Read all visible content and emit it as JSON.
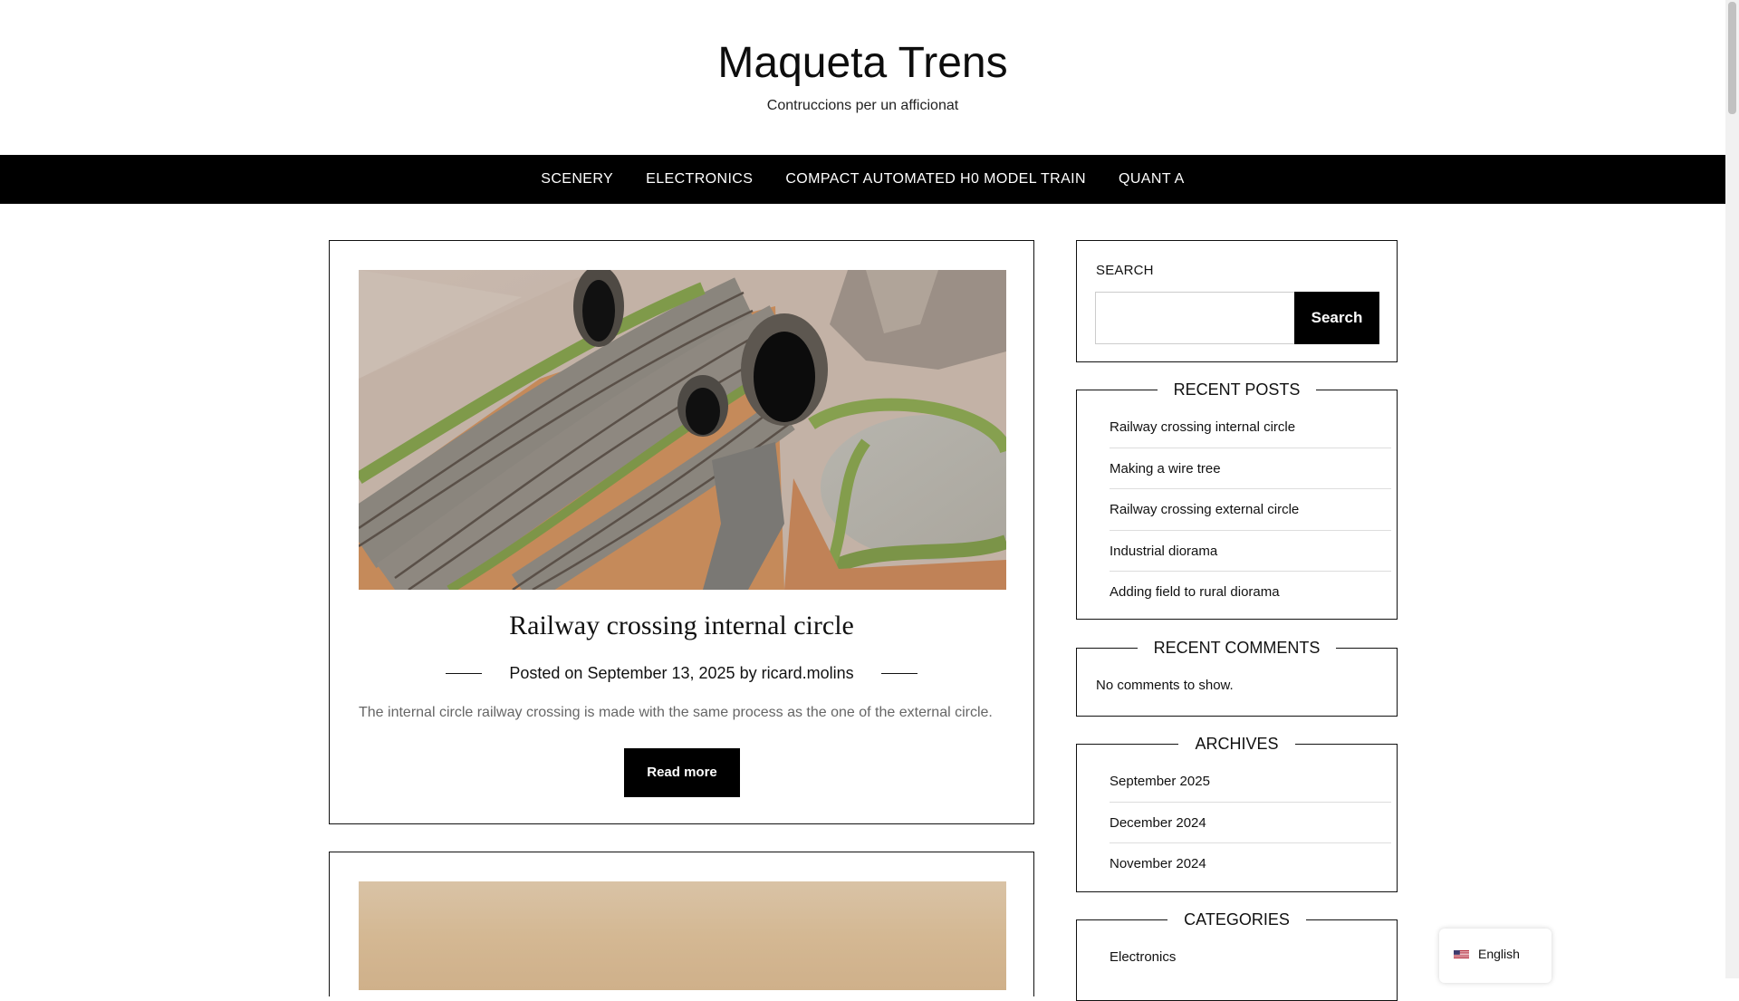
{
  "header": {
    "title": "Maqueta Trens",
    "tagline": "Contruccions per un afficionat"
  },
  "nav": {
    "items": [
      "SCENERY",
      "ELECTRONICS",
      "COMPACT AUTOMATED H0 MODEL TRAIN",
      "QUANT A"
    ]
  },
  "post": {
    "title": "Railway crossing internal circle",
    "meta_prefix": "Posted on",
    "date": "September 13, 2025",
    "meta_by": "by",
    "author": "ricard.molins",
    "excerpt": "The internal circle railway crossing is made with the same process as the one of the external circle.",
    "read_more": "Read more"
  },
  "sidebar": {
    "search": {
      "label": "SEARCH",
      "placeholder": "",
      "button": "Search"
    },
    "recent_posts": {
      "heading": "RECENT POSTS",
      "items": [
        "Railway crossing internal circle",
        "Making a wire tree",
        "Railway crossing external circle",
        "Industrial diorama",
        "Adding field to rural diorama"
      ]
    },
    "recent_comments": {
      "heading": "RECENT COMMENTS",
      "empty": "No comments to show."
    },
    "archives": {
      "heading": "ARCHIVES",
      "items": [
        "September 2025",
        "December 2024",
        "November 2024"
      ]
    },
    "categories": {
      "heading": "CATEGORIES",
      "items": [
        "Electronics"
      ]
    }
  },
  "language": {
    "label": "English",
    "flag_icon": "us-flag-icon"
  },
  "colors": {
    "nav_background": "#000000",
    "button_background": "#000000",
    "text": "#111111",
    "excerpt_text": "#666666"
  }
}
